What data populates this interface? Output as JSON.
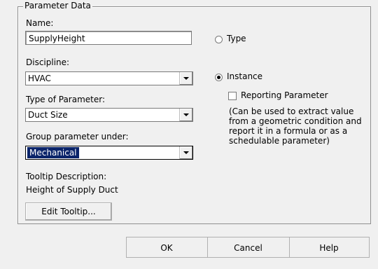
{
  "group": {
    "title": "Parameter Data"
  },
  "name": {
    "label": "Name:",
    "value": "SupplyHeight"
  },
  "discipline": {
    "label": "Discipline:",
    "value": "HVAC"
  },
  "type_of_parameter": {
    "label": "Type of Parameter:",
    "value": "Duct Size"
  },
  "group_under": {
    "label": "Group parameter under:",
    "value": "Mechanical"
  },
  "tooltip": {
    "label": "Tooltip Description:",
    "value": "Height of Supply Duct",
    "edit_button": "Edit Tooltip..."
  },
  "radio_type": {
    "label": "Type",
    "selected": false
  },
  "radio_instance": {
    "label": "Instance",
    "selected": true
  },
  "reporting": {
    "label": "Reporting Parameter",
    "checked": false,
    "note": "(Can be used to extract value from a geometric condition and report it in a formula or as a schedulable parameter)"
  },
  "buttons": {
    "ok": "OK",
    "cancel": "Cancel",
    "help": "Help"
  }
}
